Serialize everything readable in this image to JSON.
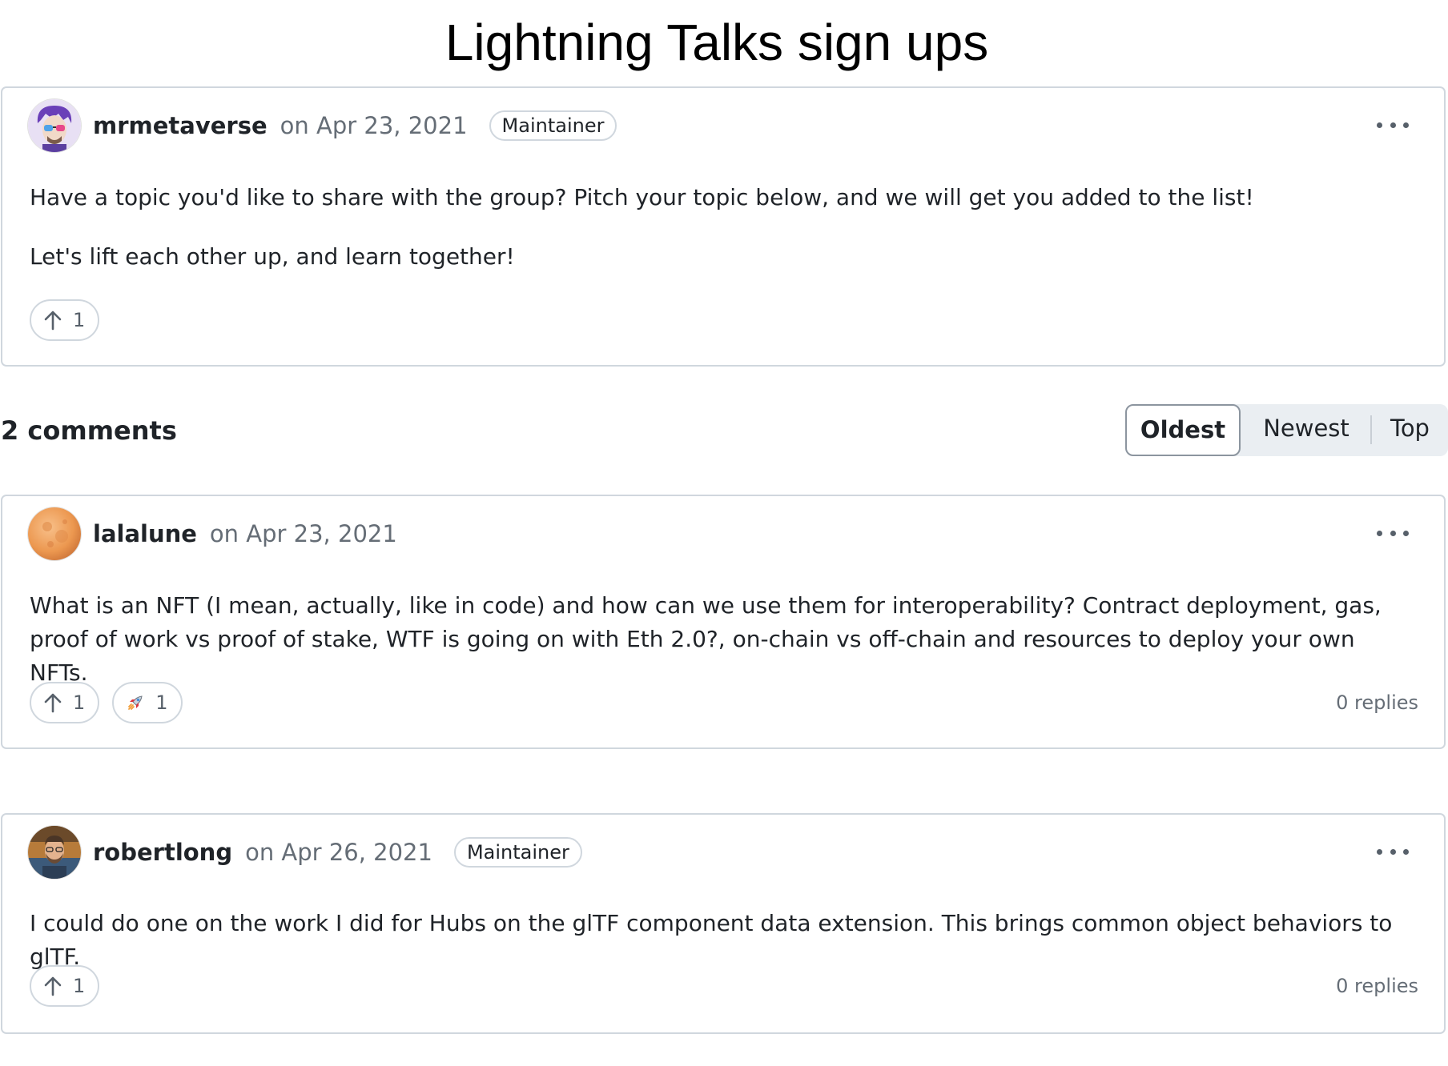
{
  "title": "Lightning Talks sign ups",
  "post": {
    "author": "mrmetaverse",
    "date": "on Apr 23, 2021",
    "badge": "Maintainer",
    "paragraphs": [
      "Have a topic you'd like to share with the group? Pitch your topic below, and we will get you added to the list!",
      "Let's lift each other up, and learn together!"
    ],
    "upvotes": "1"
  },
  "comments_heading": "2 comments",
  "sort": {
    "options": [
      "Oldest",
      "Newest",
      "Top"
    ],
    "selected": "Oldest"
  },
  "comments": [
    {
      "author": "lalalune",
      "date": "on Apr 23, 2021",
      "body": "What is an NFT (I mean, actually, like in code) and how can we use them for interoperability? Contract deployment, gas, proof of work vs proof of stake, WTF is going on with Eth 2.0?, on-chain vs off-chain and resources to deploy your own NFTs.",
      "upvotes": "1",
      "rocket_reactions": "1",
      "replies": "0 replies"
    },
    {
      "author": "robertlong",
      "date": "on Apr 26, 2021",
      "badge": "Maintainer",
      "body": "I could do one on the work I did for Hubs on the glTF component data extension. This brings common object behaviors to glTF.",
      "upvotes": "1",
      "replies": "0 replies"
    }
  ],
  "icons": {
    "upvote": "arrow-up-icon",
    "reaction": "rocket-icon",
    "menu": "kebab-menu-icon"
  },
  "colors": {
    "border": "#d0d7de",
    "muted_text": "#656d76",
    "text": "#1f2328",
    "sort_bg": "#eaeef2"
  }
}
